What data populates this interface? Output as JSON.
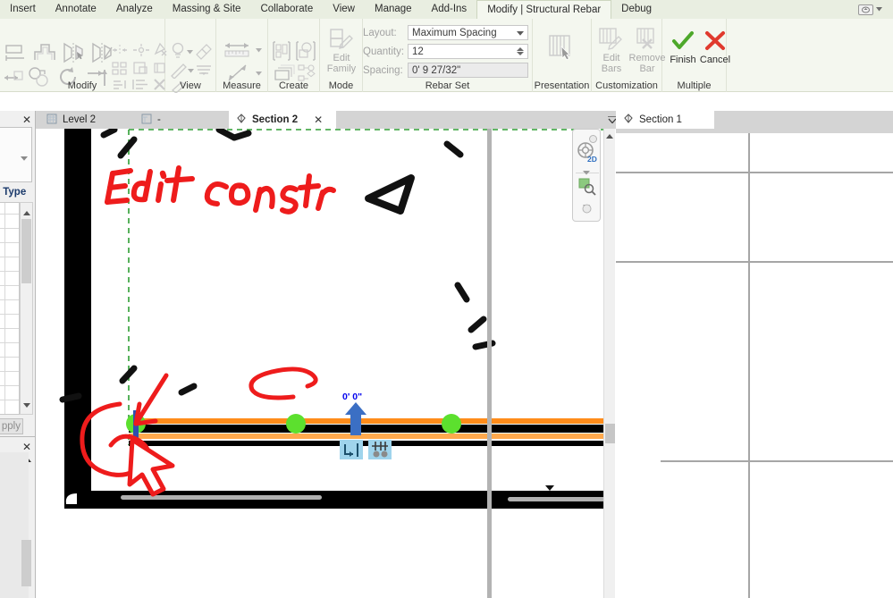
{
  "app": {
    "title": "Autodesk Revit — Structural Rebar"
  },
  "ribbon": {
    "tabs": [
      {
        "label": "Insert",
        "active": false
      },
      {
        "label": "Annotate",
        "active": false
      },
      {
        "label": "Analyze",
        "active": false
      },
      {
        "label": "Massing & Site",
        "active": false
      },
      {
        "label": "Collaborate",
        "active": false
      },
      {
        "label": "View",
        "active": false
      },
      {
        "label": "Manage",
        "active": false
      },
      {
        "label": "Add-Ins",
        "active": false
      },
      {
        "label": "Modify | Structural Rebar",
        "active": true
      },
      {
        "label": "Debug",
        "active": false
      }
    ],
    "panels": [
      {
        "label": "Modify"
      },
      {
        "label": "View"
      },
      {
        "label": "Measure"
      },
      {
        "label": "Create"
      },
      {
        "label": "Mode"
      },
      {
        "label": "Rebar Set"
      },
      {
        "label": "Presentation"
      },
      {
        "label": "Customization"
      },
      {
        "label": "Multiple"
      }
    ],
    "mode": {
      "edit_family_line1": "Edit",
      "edit_family_line2": "Family"
    },
    "rebar_set": {
      "layout_label": "Layout:",
      "layout_value": "Maximum Spacing",
      "quantity_label": "Quantity:",
      "quantity_value": "12",
      "spacing_label": "Spacing:",
      "spacing_value": "0'  9 27/32\""
    },
    "customization": {
      "edit_bars_line1": "Edit",
      "edit_bars_line2": "Bars",
      "remove_bar_line1": "Remove",
      "remove_bar_line2": "Bar"
    },
    "multiple": {
      "finish_label": "Finish",
      "cancel_label": "Cancel"
    }
  },
  "view_tabs": [
    {
      "label": "Level 2",
      "icon": "floorplan-icon",
      "selected": false,
      "closable": false
    },
    {
      "label": "-",
      "icon": "sheet-icon",
      "selected": false,
      "closable": false
    },
    {
      "label": "Section 2",
      "icon": "section-icon",
      "selected": true,
      "closable": true
    },
    {
      "label": "Section 1",
      "icon": "section-icon",
      "selected": false,
      "closable": false
    }
  ],
  "properties_palette": {
    "edit_type_label": "dit Type",
    "apply_label": "pply"
  },
  "canvas": {
    "annotation_text_1": "Edit",
    "annotation_text_2": "constr",
    "dimension_value": "0'  0\"",
    "nav_2d_label": "2D"
  },
  "colors": {
    "ribbon_bg": "#f4f7ef",
    "tab_bg": "#e9eee1",
    "annotation_red": "#ee1c1c",
    "rebar_orange": "#ff8c1a",
    "rebar_orange_light": "#ffa94d",
    "grip_green": "#5ce02e",
    "arrow_blue": "#3b6fc4",
    "dim_blue": "#0000ee",
    "control_blue": "#9fd4ec",
    "crop_green": "#2e9e34",
    "finish_green": "#4da82a",
    "cancel_red": "#e03a2e"
  }
}
